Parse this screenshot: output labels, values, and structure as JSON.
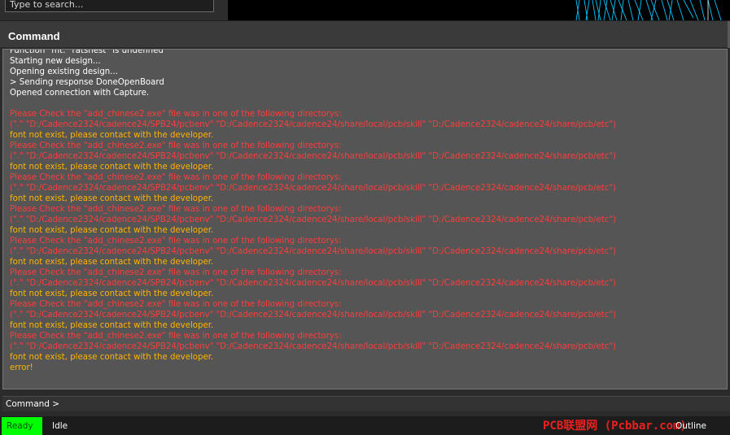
{
  "search": {
    "placeholder": "Type to search..."
  },
  "command_panel": {
    "title": "Command",
    "log_lines": [
      {
        "text": "Function \"mt: \"ratsnest\" is undefined",
        "color": "white"
      },
      {
        "text": "Starting new design...",
        "color": "white"
      },
      {
        "text": "Opening existing design...",
        "color": "white"
      },
      {
        "text": "> Sending response DoneOpenBoard",
        "color": "white"
      },
      {
        "text": "Opened connection with Capture.",
        "color": "white"
      },
      {
        "text": "",
        "color": "white"
      },
      {
        "text": "Please Check the \"add_chinese2.exe\" file was in one of the following directorys:",
        "color": "red"
      },
      {
        "text": "(\".\" \"D:/Cadence2324/cadence24/SPB24/pcbenv\" \"D:/Cadence2324/cadence24/share/local/pcb/skill\" \"D:/Cadence2324/cadence24/share/pcb/etc\")",
        "color": "red"
      },
      {
        "text": "font not exist, please contact with the developer.",
        "color": "yellow"
      },
      {
        "text": "Please Check the \"add_chinese2.exe\" file was in one of the following directorys:",
        "color": "red"
      },
      {
        "text": "(\".\" \"D:/Cadence2324/cadence24/SPB24/pcbenv\" \"D:/Cadence2324/cadence24/share/local/pcb/skill\" \"D:/Cadence2324/cadence24/share/pcb/etc\")",
        "color": "red"
      },
      {
        "text": "font not exist, please contact with the developer.",
        "color": "yellow"
      },
      {
        "text": "Please Check the \"add_chinese2.exe\" file was in one of the following directorys:",
        "color": "red"
      },
      {
        "text": "(\".\" \"D:/Cadence2324/cadence24/SPB24/pcbenv\" \"D:/Cadence2324/cadence24/share/local/pcb/skill\" \"D:/Cadence2324/cadence24/share/pcb/etc\")",
        "color": "red"
      },
      {
        "text": "font not exist, please contact with the developer.",
        "color": "yellow"
      },
      {
        "text": "Please Check the \"add_chinese2.exe\" file was in one of the following directorys:",
        "color": "red"
      },
      {
        "text": "(\".\" \"D:/Cadence2324/cadence24/SPB24/pcbenv\" \"D:/Cadence2324/cadence24/share/local/pcb/skill\" \"D:/Cadence2324/cadence24/share/pcb/etc\")",
        "color": "red"
      },
      {
        "text": "font not exist, please contact with the developer.",
        "color": "yellow"
      },
      {
        "text": "Please Check the \"add_chinese2.exe\" file was in one of the following directorys:",
        "color": "red"
      },
      {
        "text": "(\".\" \"D:/Cadence2324/cadence24/SPB24/pcbenv\" \"D:/Cadence2324/cadence24/share/local/pcb/skill\" \"D:/Cadence2324/cadence24/share/pcb/etc\")",
        "color": "red"
      },
      {
        "text": "font not exist, please contact with the developer.",
        "color": "yellow"
      },
      {
        "text": "Please Check the \"add_chinese2.exe\" file was in one of the following directorys:",
        "color": "red"
      },
      {
        "text": "(\".\" \"D:/Cadence2324/cadence24/SPB24/pcbenv\" \"D:/Cadence2324/cadence24/share/local/pcb/skill\" \"D:/Cadence2324/cadence24/share/pcb/etc\")",
        "color": "red"
      },
      {
        "text": "font not exist, please contact with the developer.",
        "color": "yellow"
      },
      {
        "text": "Please Check the \"add_chinese2.exe\" file was in one of the following directorys:",
        "color": "red"
      },
      {
        "text": "(\".\" \"D:/Cadence2324/cadence24/SPB24/pcbenv\" \"D:/Cadence2324/cadence24/share/local/pcb/skill\" \"D:/Cadence2324/cadence24/share/pcb/etc\")",
        "color": "red"
      },
      {
        "text": "font not exist, please contact with the developer.",
        "color": "yellow"
      },
      {
        "text": "Please Check the \"add_chinese2.exe\" file was in one of the following directorys:",
        "color": "red"
      },
      {
        "text": "(\".\" \"D:/Cadence2324/cadence24/SPB24/pcbenv\" \"D:/Cadence2324/cadence24/share/local/pcb/skill\" \"D:/Cadence2324/cadence24/share/pcb/etc\")",
        "color": "red"
      },
      {
        "text": "font not exist, please contact with the developer.",
        "color": "yellow"
      },
      {
        "text": "error!",
        "color": "yellow"
      }
    ],
    "prompt": "Command >",
    "input_value": ""
  },
  "status_bar": {
    "ready": "Ready",
    "idle": "Idle",
    "outline": "Outline",
    "watermark": "PCB联盟网 (Pcbbar.com)"
  },
  "colors": {
    "white": "#ffffff",
    "red": "#ff3c3c",
    "yellow": "#ffb300",
    "ready_bg": "#00ff00",
    "console_bg": "#555555",
    "canvas_lines": "#00c8ff"
  }
}
